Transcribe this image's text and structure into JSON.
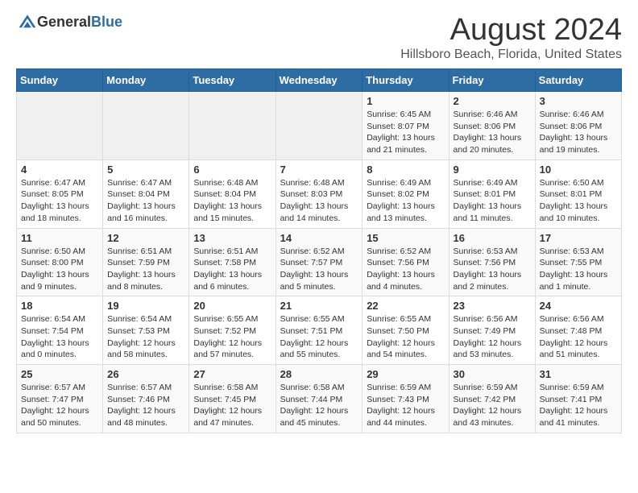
{
  "header": {
    "logo_general": "General",
    "logo_blue": "Blue",
    "month": "August 2024",
    "location": "Hillsboro Beach, Florida, United States"
  },
  "days_of_week": [
    "Sunday",
    "Monday",
    "Tuesday",
    "Wednesday",
    "Thursday",
    "Friday",
    "Saturday"
  ],
  "weeks": [
    [
      {
        "day": "",
        "info": ""
      },
      {
        "day": "",
        "info": ""
      },
      {
        "day": "",
        "info": ""
      },
      {
        "day": "",
        "info": ""
      },
      {
        "day": "1",
        "info": "Sunrise: 6:45 AM\nSunset: 8:07 PM\nDaylight: 13 hours and 21 minutes."
      },
      {
        "day": "2",
        "info": "Sunrise: 6:46 AM\nSunset: 8:06 PM\nDaylight: 13 hours and 20 minutes."
      },
      {
        "day": "3",
        "info": "Sunrise: 6:46 AM\nSunset: 8:06 PM\nDaylight: 13 hours and 19 minutes."
      }
    ],
    [
      {
        "day": "4",
        "info": "Sunrise: 6:47 AM\nSunset: 8:05 PM\nDaylight: 13 hours and 18 minutes."
      },
      {
        "day": "5",
        "info": "Sunrise: 6:47 AM\nSunset: 8:04 PM\nDaylight: 13 hours and 16 minutes."
      },
      {
        "day": "6",
        "info": "Sunrise: 6:48 AM\nSunset: 8:04 PM\nDaylight: 13 hours and 15 minutes."
      },
      {
        "day": "7",
        "info": "Sunrise: 6:48 AM\nSunset: 8:03 PM\nDaylight: 13 hours and 14 minutes."
      },
      {
        "day": "8",
        "info": "Sunrise: 6:49 AM\nSunset: 8:02 PM\nDaylight: 13 hours and 13 minutes."
      },
      {
        "day": "9",
        "info": "Sunrise: 6:49 AM\nSunset: 8:01 PM\nDaylight: 13 hours and 11 minutes."
      },
      {
        "day": "10",
        "info": "Sunrise: 6:50 AM\nSunset: 8:01 PM\nDaylight: 13 hours and 10 minutes."
      }
    ],
    [
      {
        "day": "11",
        "info": "Sunrise: 6:50 AM\nSunset: 8:00 PM\nDaylight: 13 hours and 9 minutes."
      },
      {
        "day": "12",
        "info": "Sunrise: 6:51 AM\nSunset: 7:59 PM\nDaylight: 13 hours and 8 minutes."
      },
      {
        "day": "13",
        "info": "Sunrise: 6:51 AM\nSunset: 7:58 PM\nDaylight: 13 hours and 6 minutes."
      },
      {
        "day": "14",
        "info": "Sunrise: 6:52 AM\nSunset: 7:57 PM\nDaylight: 13 hours and 5 minutes."
      },
      {
        "day": "15",
        "info": "Sunrise: 6:52 AM\nSunset: 7:56 PM\nDaylight: 13 hours and 4 minutes."
      },
      {
        "day": "16",
        "info": "Sunrise: 6:53 AM\nSunset: 7:56 PM\nDaylight: 13 hours and 2 minutes."
      },
      {
        "day": "17",
        "info": "Sunrise: 6:53 AM\nSunset: 7:55 PM\nDaylight: 13 hours and 1 minute."
      }
    ],
    [
      {
        "day": "18",
        "info": "Sunrise: 6:54 AM\nSunset: 7:54 PM\nDaylight: 13 hours and 0 minutes."
      },
      {
        "day": "19",
        "info": "Sunrise: 6:54 AM\nSunset: 7:53 PM\nDaylight: 12 hours and 58 minutes."
      },
      {
        "day": "20",
        "info": "Sunrise: 6:55 AM\nSunset: 7:52 PM\nDaylight: 12 hours and 57 minutes."
      },
      {
        "day": "21",
        "info": "Sunrise: 6:55 AM\nSunset: 7:51 PM\nDaylight: 12 hours and 55 minutes."
      },
      {
        "day": "22",
        "info": "Sunrise: 6:55 AM\nSunset: 7:50 PM\nDaylight: 12 hours and 54 minutes."
      },
      {
        "day": "23",
        "info": "Sunrise: 6:56 AM\nSunset: 7:49 PM\nDaylight: 12 hours and 53 minutes."
      },
      {
        "day": "24",
        "info": "Sunrise: 6:56 AM\nSunset: 7:48 PM\nDaylight: 12 hours and 51 minutes."
      }
    ],
    [
      {
        "day": "25",
        "info": "Sunrise: 6:57 AM\nSunset: 7:47 PM\nDaylight: 12 hours and 50 minutes."
      },
      {
        "day": "26",
        "info": "Sunrise: 6:57 AM\nSunset: 7:46 PM\nDaylight: 12 hours and 48 minutes."
      },
      {
        "day": "27",
        "info": "Sunrise: 6:58 AM\nSunset: 7:45 PM\nDaylight: 12 hours and 47 minutes."
      },
      {
        "day": "28",
        "info": "Sunrise: 6:58 AM\nSunset: 7:44 PM\nDaylight: 12 hours and 45 minutes."
      },
      {
        "day": "29",
        "info": "Sunrise: 6:59 AM\nSunset: 7:43 PM\nDaylight: 12 hours and 44 minutes."
      },
      {
        "day": "30",
        "info": "Sunrise: 6:59 AM\nSunset: 7:42 PM\nDaylight: 12 hours and 43 minutes."
      },
      {
        "day": "31",
        "info": "Sunrise: 6:59 AM\nSunset: 7:41 PM\nDaylight: 12 hours and 41 minutes."
      }
    ]
  ]
}
